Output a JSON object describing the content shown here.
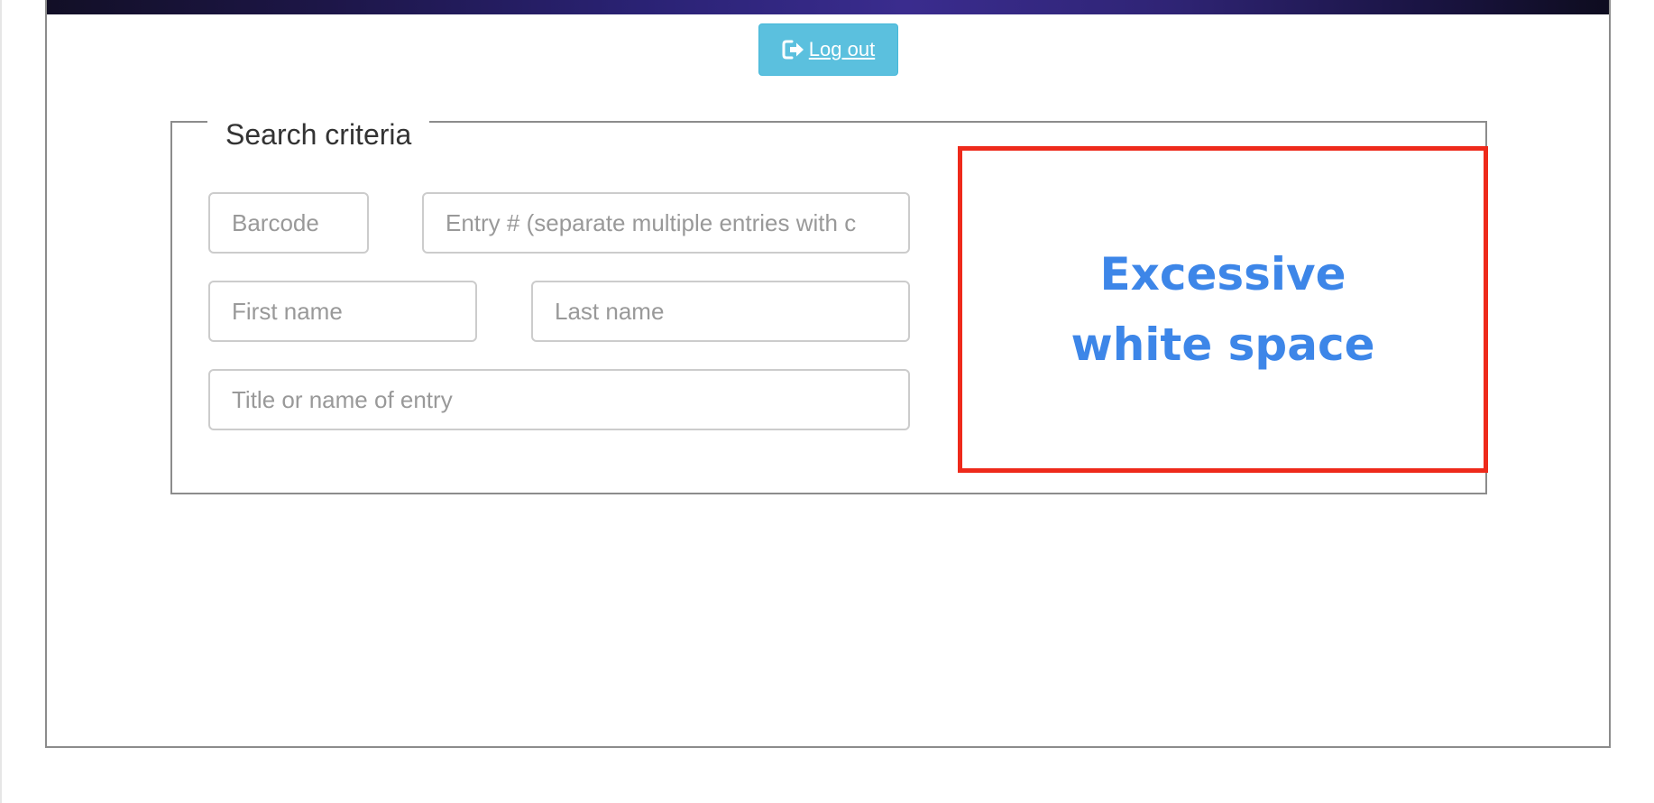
{
  "header": {
    "logout_label": "Log out",
    "logout_icon": "sign-out-icon"
  },
  "search": {
    "legend": "Search criteria",
    "barcode_placeholder": "Barcode",
    "entry_placeholder": "Entry # (separate multiple entries with c",
    "first_name_placeholder": "First name",
    "last_name_placeholder": "Last name",
    "title_placeholder": "Title or name of entry"
  },
  "annotation": {
    "text": "Excessive white space",
    "border_color": "#ee2a1b",
    "text_color": "#3d86e8"
  },
  "colors": {
    "button": "#5bc0de"
  }
}
